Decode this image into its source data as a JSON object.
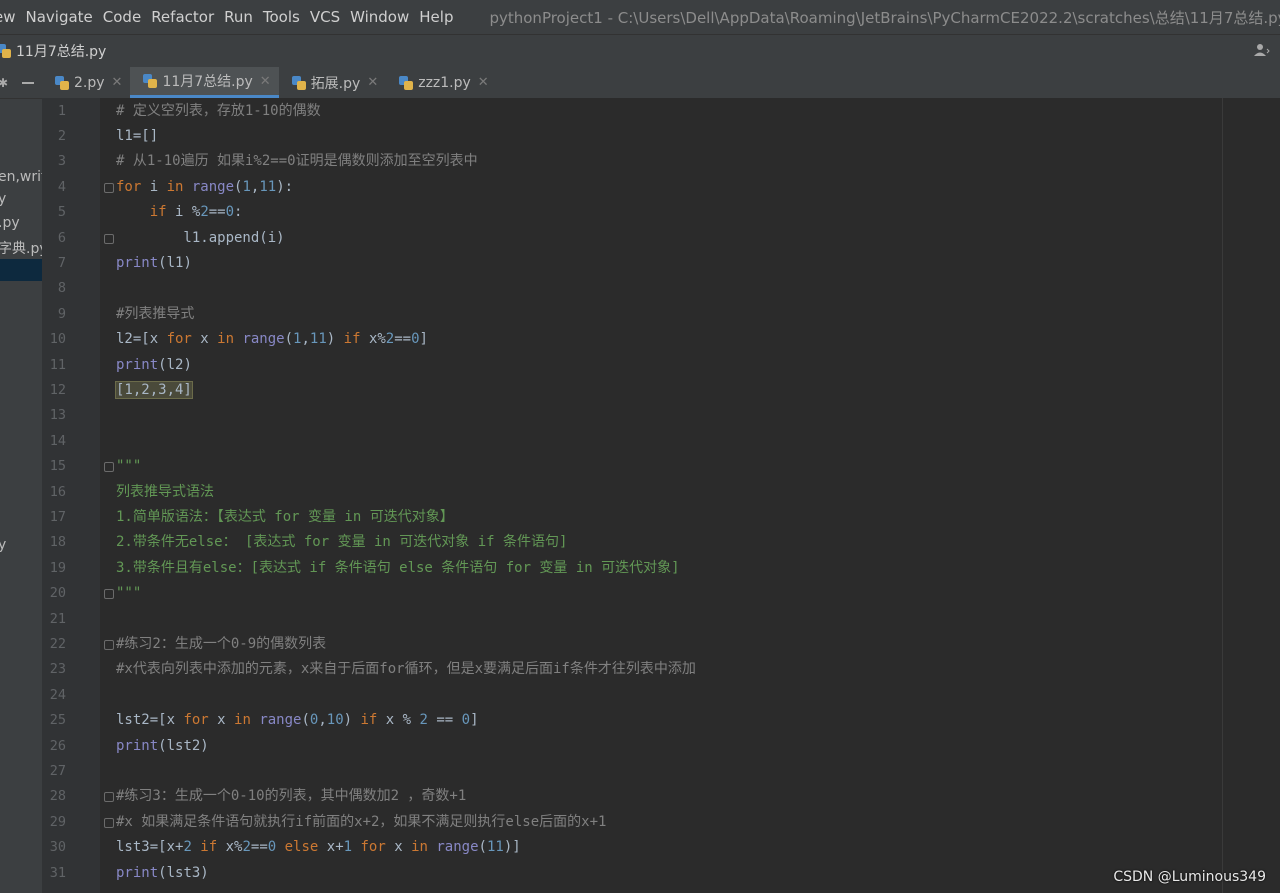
{
  "menu": [
    "ew",
    "Navigate",
    "Code",
    "Refactor",
    "Run",
    "Tools",
    "VCS",
    "Window",
    "Help"
  ],
  "window_title": "pythonProject1 - C:\\Users\\Dell\\AppData\\Roaming\\JetBrains\\PyCharmCE2022.2\\scratches\\总结\\11月7总结.py",
  "breadcrumb": "11月7总结.py",
  "left_panel_items": [
    "en,writ",
    "y",
    ".py",
    "字典.py",
    "y"
  ],
  "tabs": [
    {
      "label": "2.py",
      "active": false
    },
    {
      "label": "11月7总结.py",
      "active": true
    },
    {
      "label": "拓展.py",
      "active": false
    },
    {
      "label": "zzz1.py",
      "active": false
    }
  ],
  "code_lines": [
    {
      "n": "1",
      "parts": [
        [
          "c",
          "# 定义空列表，存放1-10的偶数"
        ]
      ]
    },
    {
      "n": "2",
      "parts": [
        [
          "p",
          "l1=[]"
        ]
      ]
    },
    {
      "n": "3",
      "parts": [
        [
          "c",
          "# 从1-10遍历 如果i%2==0证明是偶数则添加至空列表中"
        ]
      ]
    },
    {
      "n": "4",
      "parts": [
        [
          "k",
          "for "
        ],
        [
          "p",
          "i "
        ],
        [
          "k",
          "in "
        ],
        [
          "f",
          "range"
        ],
        [
          "p",
          "("
        ],
        [
          "n",
          "1"
        ],
        [
          "p",
          ","
        ],
        [
          "n",
          "11"
        ],
        [
          "p",
          "):"
        ]
      ]
    },
    {
      "n": "5",
      "parts": [
        [
          "p",
          "    "
        ],
        [
          "k",
          "if "
        ],
        [
          "p",
          "i %"
        ],
        [
          "n",
          "2"
        ],
        [
          "p",
          "=="
        ],
        [
          "n",
          "0"
        ],
        [
          "p",
          ":"
        ]
      ]
    },
    {
      "n": "6",
      "parts": [
        [
          "p",
          "        l1.append(i)"
        ]
      ]
    },
    {
      "n": "7",
      "parts": [
        [
          "f",
          "print"
        ],
        [
          "p",
          "(l1)"
        ]
      ]
    },
    {
      "n": "8",
      "parts": []
    },
    {
      "n": "9",
      "parts": [
        [
          "c",
          "#列表推导式"
        ]
      ]
    },
    {
      "n": "10",
      "parts": [
        [
          "p",
          "l2=[x "
        ],
        [
          "k",
          "for "
        ],
        [
          "p",
          "x "
        ],
        [
          "k",
          "in "
        ],
        [
          "f",
          "range"
        ],
        [
          "p",
          "("
        ],
        [
          "n",
          "1"
        ],
        [
          "p",
          ","
        ],
        [
          "n",
          "11"
        ],
        [
          "p",
          ") "
        ],
        [
          "k",
          "if "
        ],
        [
          "p",
          "x%"
        ],
        [
          "n",
          "2"
        ],
        [
          "p",
          "=="
        ],
        [
          "n",
          "0"
        ],
        [
          "p",
          "]"
        ]
      ]
    },
    {
      "n": "11",
      "parts": [
        [
          "f",
          "print"
        ],
        [
          "p",
          "(l2)"
        ]
      ]
    },
    {
      "n": "12",
      "parts": [
        [
          "h",
          "[1,2,3,4]"
        ]
      ]
    },
    {
      "n": "13",
      "parts": []
    },
    {
      "n": "14",
      "parts": []
    },
    {
      "n": "15",
      "parts": [
        [
          "d",
          "\"\"\""
        ]
      ]
    },
    {
      "n": "16",
      "parts": [
        [
          "d",
          "列表推导式语法"
        ]
      ]
    },
    {
      "n": "17",
      "parts": [
        [
          "d",
          "1.简单版语法：【表达式 for 变量 in 可迭代对象】"
        ]
      ]
    },
    {
      "n": "18",
      "parts": [
        [
          "d",
          "2.带条件无else： [表达式 for 变量 in 可迭代对象 if 条件语句]"
        ]
      ]
    },
    {
      "n": "19",
      "parts": [
        [
          "d",
          "3.带条件且有else：[表达式 if 条件语句 else 条件语句 for 变量 in 可迭代对象]"
        ]
      ]
    },
    {
      "n": "20",
      "parts": [
        [
          "d",
          "\"\"\""
        ]
      ]
    },
    {
      "n": "21",
      "parts": []
    },
    {
      "n": "22",
      "parts": [
        [
          "c",
          "#练习2：生成一个0-9的偶数列表"
        ]
      ]
    },
    {
      "n": "23",
      "parts": [
        [
          "c",
          "#x代表向列表中添加的元素，x来自于后面for循环，但是x要满足后面if条件才往列表中添加"
        ]
      ]
    },
    {
      "n": "24",
      "parts": []
    },
    {
      "n": "25",
      "parts": [
        [
          "p",
          "lst2=[x "
        ],
        [
          "k",
          "for "
        ],
        [
          "p",
          "x "
        ],
        [
          "k",
          "in "
        ],
        [
          "f",
          "range"
        ],
        [
          "p",
          "("
        ],
        [
          "n",
          "0"
        ],
        [
          "p",
          ","
        ],
        [
          "n",
          "10"
        ],
        [
          "p",
          ") "
        ],
        [
          "k",
          "if "
        ],
        [
          "p",
          "x % "
        ],
        [
          "n",
          "2"
        ],
        [
          "p",
          " == "
        ],
        [
          "n",
          "0"
        ],
        [
          "p",
          "]"
        ]
      ]
    },
    {
      "n": "26",
      "parts": [
        [
          "f",
          "print"
        ],
        [
          "p",
          "(lst2)"
        ]
      ]
    },
    {
      "n": "27",
      "parts": []
    },
    {
      "n": "28",
      "parts": [
        [
          "c",
          "#练习3：生成一个0-10的列表，其中偶数加2 ，奇数+1"
        ]
      ]
    },
    {
      "n": "29",
      "parts": [
        [
          "c",
          "#x 如果满足条件语句就执行if前面的x+2，如果不满足则执行else后面的x+1"
        ]
      ]
    },
    {
      "n": "30",
      "parts": [
        [
          "p",
          "lst3=[x+"
        ],
        [
          "n",
          "2 "
        ],
        [
          "k",
          "if "
        ],
        [
          "p",
          "x%"
        ],
        [
          "n",
          "2"
        ],
        [
          "p",
          "=="
        ],
        [
          "n",
          "0 "
        ],
        [
          "k",
          "else "
        ],
        [
          "p",
          "x+"
        ],
        [
          "n",
          "1 "
        ],
        [
          "k",
          "for "
        ],
        [
          "p",
          "x "
        ],
        [
          "k",
          "in "
        ],
        [
          "f",
          "range"
        ],
        [
          "p",
          "("
        ],
        [
          "n",
          "11"
        ],
        [
          "p",
          ")]"
        ]
      ]
    },
    {
      "n": "31",
      "parts": [
        [
          "f",
          "print"
        ],
        [
          "p",
          "(lst3)"
        ]
      ]
    }
  ],
  "watermark": "CSDN @Luminous349",
  "colors": {
    "comment": "#808080",
    "docstring": "#629755",
    "keyword": "#cc7832",
    "number": "#6897bb",
    "builtin": "#8888c6",
    "text": "#a9b7c6",
    "tab_active_underline": "#4a88c7"
  }
}
